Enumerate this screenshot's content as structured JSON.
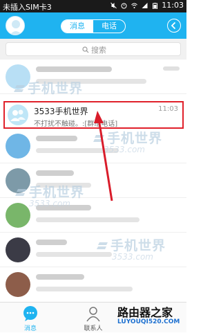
{
  "status_bar": {
    "carrier": "未插入SIM卡3",
    "time": "11:03"
  },
  "header": {
    "tabs": [
      {
        "label": "消息",
        "active": true
      },
      {
        "label": "电话",
        "active": false
      }
    ]
  },
  "search": {
    "placeholder": "搜索"
  },
  "highlighted_conversation": {
    "name": "3533手机世界",
    "message": "不打扰不触碰。:[群组电话]",
    "time": "11:03"
  },
  "watermarks": {
    "text": "手机世界",
    "url": "3533.com"
  },
  "bottom_nav": {
    "items": [
      {
        "label": "消息",
        "active": true
      },
      {
        "label": "联系人",
        "active": false
      }
    ]
  },
  "corner_brand": {
    "title": "路由器之家",
    "url": "LUYOUQI520.COM"
  },
  "colors": {
    "accent": "#1fb3f0",
    "highlight_border": "#e0202a"
  }
}
